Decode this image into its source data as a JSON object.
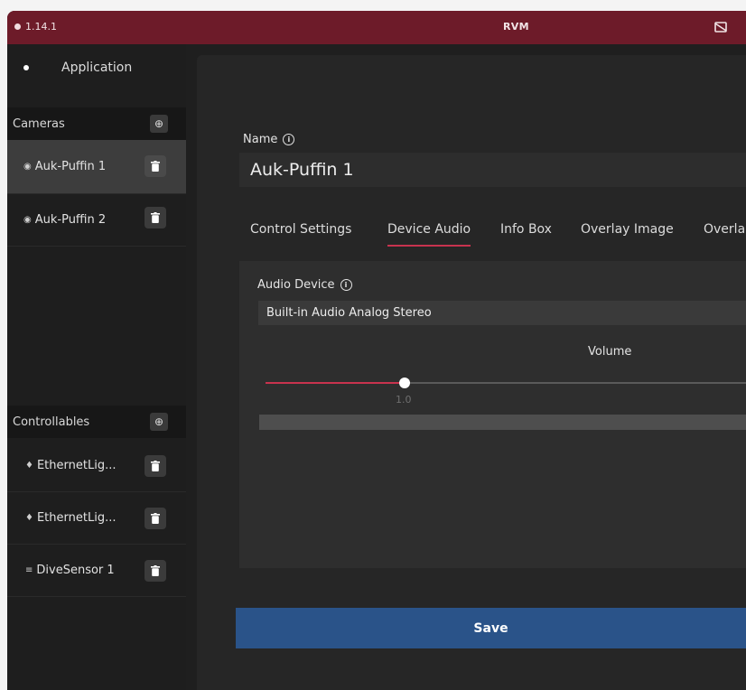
{
  "window": {
    "version": "1.14.1",
    "title": "RVM",
    "title_icon": "no-video-icon",
    "title_bar_color": "#6d1b29"
  },
  "sidebar": {
    "application_label": "Application",
    "cameras": {
      "header": "Cameras",
      "add_icon": "add-circle-icon",
      "items": [
        {
          "icon": "◉",
          "label": "Auk-Puffin 1",
          "selected": true
        },
        {
          "icon": "◉",
          "label": "Auk-Puffin 2",
          "selected": false
        }
      ]
    },
    "controllables": {
      "header": "Controllables",
      "add_icon": "add-circle-icon",
      "items": [
        {
          "icon": "♦",
          "label": "EthernetLig..."
        },
        {
          "icon": "♦",
          "label": "EthernetLig..."
        },
        {
          "icon": "≡",
          "label": "DiveSensor 1"
        }
      ]
    }
  },
  "main": {
    "name_label": "Name",
    "name_value": "Auk-Puffin 1",
    "tabs": [
      {
        "label": "Control Settings",
        "active": false
      },
      {
        "label": "Device Audio",
        "active": true
      },
      {
        "label": "Info Box",
        "active": false
      },
      {
        "label": "Overlay Image",
        "active": false
      },
      {
        "label": "Overla",
        "active": false
      }
    ],
    "audio": {
      "device_label": "Audio Device",
      "device_value": "Built-in Audio Analog Stereo",
      "volume_label": "Volume",
      "volume_value": "1.0",
      "volume_fraction": 0.29
    },
    "save_label": "Save"
  },
  "colors": {
    "accent": "#c8334e",
    "save_button": "#2a5389"
  }
}
